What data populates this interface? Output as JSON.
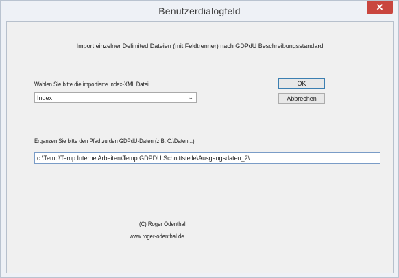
{
  "window": {
    "title": "Benutzerdialogfeld",
    "close_glyph": "✕"
  },
  "dialog": {
    "heading": "Import einzelner Delimited Dateien (mit Feldtrenner) nach GDPdU Beschreibungsstandard",
    "index_label": "Wahlen Sie bitte die importierte Index-XML Datei",
    "index_select": {
      "selected": "Index",
      "arrow": "⌄"
    },
    "ok_label": "OK",
    "cancel_label": "Abbrechen",
    "path_label": "Erganzen Sie bitte den Pfad zu den GDPdU-Daten (z.B. C:\\Daten...)",
    "path_value": "c:\\Temp\\Temp Interne Arbeiten\\Temp GDPDU Schnittstelle\\Ausgangsdaten_2\\",
    "copyright": "(C) Roger Odenthal",
    "website": "www.roger-odenthal.de"
  },
  "icons": {
    "close": "close-icon",
    "dropdown": "chevron-down-icon"
  },
  "colors": {
    "close_button": "#c9463f",
    "window_bg": "#eef1f6",
    "client_bg": "#f0f0f0",
    "default_button_border": "#3c7fb1"
  }
}
